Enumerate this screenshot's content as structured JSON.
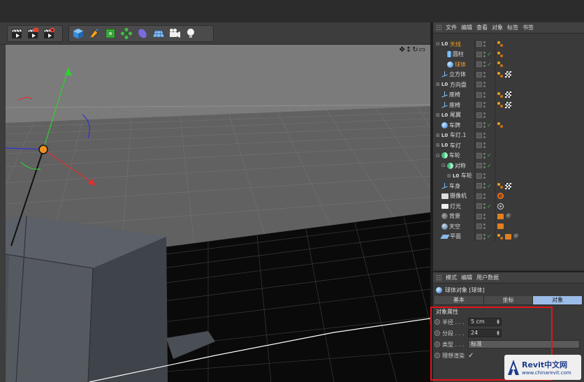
{
  "toolbar": {
    "groups": [
      {
        "buttons": [
          {
            "icon": "render-view-icon"
          },
          {
            "icon": "render-picture-viewer-icon"
          },
          {
            "icon": "render-settings-icon"
          }
        ]
      },
      {
        "buttons": [
          {
            "icon": "cube-icon"
          },
          {
            "icon": "pen-icon"
          },
          {
            "icon": "subdivision-icon"
          },
          {
            "icon": "array-icon"
          },
          {
            "icon": "deformer-icon"
          },
          {
            "icon": "floor-icon"
          },
          {
            "icon": "camera-icon"
          },
          {
            "icon": "light-bulb-icon"
          }
        ]
      }
    ]
  },
  "viewport": {
    "nav_icons": [
      "move-view-icon",
      "zoom-view-icon",
      "rotate-view-icon",
      "maximize-view-icon"
    ],
    "colors": {
      "bg": "#7a7a7a",
      "floor": "#5e5e5e",
      "dark_floor": "#0c0c0c"
    }
  },
  "object_manager": {
    "menu": [
      "文件",
      "编辑",
      "查看",
      "对象",
      "标签",
      "书签"
    ],
    "objects": [
      {
        "name": "天线",
        "icon": "null",
        "indent": 0,
        "tree": "⊟",
        "active": true,
        "visible": "",
        "tags": [
          "orange"
        ]
      },
      {
        "name": "圆柱",
        "icon": "cylinder",
        "indent": 2,
        "tree": "",
        "active": false,
        "visible": "✓",
        "tags": [
          "orange"
        ]
      },
      {
        "name": "球体",
        "icon": "sphere",
        "indent": 2,
        "tree": "",
        "active": true,
        "visible": "✓",
        "tags": [
          "orange"
        ]
      },
      {
        "name": "立方体",
        "icon": "axis",
        "indent": 1,
        "tree": "",
        "active": false,
        "visible": "",
        "tags": [
          "orange",
          "checker"
        ]
      },
      {
        "name": "方向盘",
        "icon": "null",
        "indent": 0,
        "tree": "⊞",
        "active": false,
        "visible": "",
        "tags": []
      },
      {
        "name": "座椅",
        "icon": "axis",
        "indent": 1,
        "tree": "",
        "active": false,
        "visible": "",
        "tags": [
          "orange",
          "checker"
        ]
      },
      {
        "name": "座椅",
        "icon": "axis",
        "indent": 1,
        "tree": "",
        "active": false,
        "visible": "",
        "tags": [
          "orange",
          "checker"
        ]
      },
      {
        "name": "尾翼",
        "icon": "null",
        "indent": 0,
        "tree": "⊞",
        "active": false,
        "visible": "",
        "tags": []
      },
      {
        "name": "车牌",
        "icon": "sphere",
        "indent": 1,
        "tree": "",
        "active": false,
        "visible": "✓",
        "tags": [
          "orange"
        ]
      },
      {
        "name": "车灯.1",
        "icon": "null",
        "indent": 0,
        "tree": "⊞",
        "active": false,
        "visible": "",
        "tags": []
      },
      {
        "name": "车灯",
        "icon": "null",
        "indent": 0,
        "tree": "⊞",
        "active": false,
        "visible": "",
        "tags": []
      },
      {
        "name": "车轮",
        "icon": "symmetry",
        "indent": 0,
        "tree": "⊟",
        "active": false,
        "visible": "✓",
        "tags": []
      },
      {
        "name": "对称",
        "icon": "symmetry",
        "indent": 1,
        "tree": "⊟",
        "active": false,
        "visible": "✓",
        "tags": []
      },
      {
        "name": "车轮",
        "icon": "null",
        "indent": 2,
        "tree": "⊞",
        "active": false,
        "visible": "",
        "tags": []
      },
      {
        "name": "车身",
        "icon": "axis",
        "indent": 1,
        "tree": "",
        "active": false,
        "visible": "✓",
        "tags": [
          "orange",
          "checker"
        ]
      },
      {
        "name": "摄像机",
        "icon": "camera",
        "indent": 1,
        "tree": "",
        "active": false,
        "visible": "",
        "tags": [
          "camera"
        ]
      },
      {
        "name": "灯光",
        "icon": "light",
        "indent": 1,
        "tree": "",
        "active": false,
        "visible": "✓",
        "tags": [
          "light"
        ]
      },
      {
        "name": "背景",
        "icon": "background",
        "indent": 1,
        "tree": "",
        "active": false,
        "visible": "",
        "tags": [
          "bg",
          "ball"
        ]
      },
      {
        "name": "天空",
        "icon": "sky",
        "indent": 1,
        "tree": "",
        "active": false,
        "visible": "",
        "tags": [
          "bg"
        ]
      },
      {
        "name": "平面",
        "icon": "plane",
        "indent": 1,
        "tree": "",
        "active": false,
        "visible": "✓",
        "tags": [
          "orange",
          "bg",
          "ball"
        ]
      }
    ]
  },
  "attribute_manager": {
    "menu": [
      "模式",
      "编辑",
      "用户数据"
    ],
    "title": "球体对象 [球体]",
    "tabs": [
      {
        "label": "基本",
        "active": false
      },
      {
        "label": "坐标",
        "active": false
      },
      {
        "label": "对象",
        "active": true
      }
    ],
    "section": "对象属性",
    "fields": {
      "radius": {
        "label": "半径 . . .",
        "value": "5 cm"
      },
      "segments": {
        "label": "分段 . . .",
        "value": "24"
      },
      "type": {
        "label": "类型 . . .",
        "value": "标准"
      },
      "render_perfect": {
        "label": "理想渲染",
        "value": "✓"
      }
    },
    "highlight_color": "#e3141b"
  },
  "watermark": {
    "main": "Revit中文网",
    "url": "www.chinarevit.com"
  }
}
